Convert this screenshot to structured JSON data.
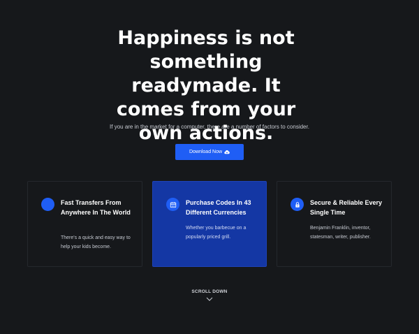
{
  "hero": {
    "title": "Happiness is not something readymade. It comes from your own actions.",
    "subtitle": "If you are in the market for a computer, there are a number of factors to consider.",
    "download_label": "Download Now",
    "download_icon": "cloud-download-icon"
  },
  "features": [
    {
      "icon": "circle-icon",
      "title": "Fast Transfers From Anywhere In The World",
      "text": "There's a quick and easy way to help your kids become."
    },
    {
      "icon": "calendar-icon",
      "title": "Purchase Codes In 43 Different Currencies",
      "text": "Whether you barbecue on a popularly priced grill."
    },
    {
      "icon": "lock-icon",
      "title": "Secure & Reliable Every Single Time",
      "text": "Benjamin Franklin, inventor, statesman, writer, publisher."
    }
  ],
  "scroll": {
    "label": "SCROLL DOWN",
    "icon": "chevron-down-icon"
  },
  "colors": {
    "background": "#16181b",
    "accent": "#1f5ef5",
    "active_card": "#1437a4"
  }
}
